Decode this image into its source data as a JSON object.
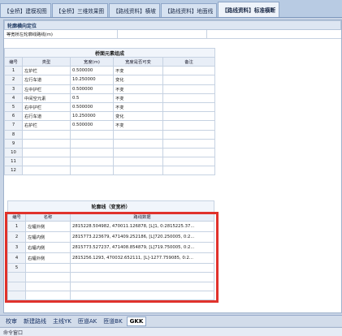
{
  "top_tabs": [
    {
      "label": "【全桥】建模视图",
      "active": false
    },
    {
      "label": "【全桥】三维效果图",
      "active": false
    },
    {
      "label": "【路线资料】横坡",
      "active": false
    },
    {
      "label": "【路线资料】地面线",
      "active": false
    },
    {
      "label": "【路线资料】标准横断",
      "active": true
    }
  ],
  "section1": {
    "title": "轮廓横向定位",
    "field_label": "等宽桥左轮廓线路线(m)",
    "field_value": ""
  },
  "section2": {
    "caption": "桥面元素组成",
    "headers": [
      "编号",
      "类型",
      "宽度(m)",
      "宽度是否可变",
      "备注"
    ],
    "rows": [
      {
        "no": "1",
        "type": "左护栏",
        "width": "0.500000",
        "variable": "不变",
        "note": ""
      },
      {
        "no": "2",
        "type": "左行车道",
        "width": "10.250000",
        "variable": "变化",
        "note": ""
      },
      {
        "no": "3",
        "type": "左中护栏",
        "width": "0.500000",
        "variable": "不变",
        "note": ""
      },
      {
        "no": "4",
        "type": "中间空元素",
        "width": "0.5",
        "variable": "不变",
        "note": ""
      },
      {
        "no": "5",
        "type": "右中护栏",
        "width": "0.500000",
        "variable": "不变",
        "note": ""
      },
      {
        "no": "6",
        "type": "右行车道",
        "width": "10.250000",
        "variable": "变化",
        "note": ""
      },
      {
        "no": "7",
        "type": "右护栏",
        "width": "0.500000",
        "variable": "不变",
        "note": ""
      },
      {
        "no": "8",
        "type": "",
        "width": "",
        "variable": "",
        "note": ""
      },
      {
        "no": "9",
        "type": "",
        "width": "",
        "variable": "",
        "note": ""
      },
      {
        "no": "10",
        "type": "",
        "width": "",
        "variable": "",
        "note": ""
      },
      {
        "no": "11",
        "type": "",
        "width": "",
        "variable": "",
        "note": ""
      },
      {
        "no": "12",
        "type": "",
        "width": "",
        "variable": "",
        "note": ""
      }
    ]
  },
  "section3": {
    "caption": "轮廓线（变宽桥）",
    "headers": [
      "编号",
      "名称",
      "路线数据"
    ],
    "rows": [
      {
        "no": "1",
        "name": "左幅外侧",
        "data": "2815228.504982, 470011.126878, [L]1, 0:2815225.37..."
      },
      {
        "no": "2",
        "name": "左幅内侧",
        "data": "2815773.223679, 471409.252186, [L]720.250005, 0:2..."
      },
      {
        "no": "3",
        "name": "右幅内侧",
        "data": "2815773.527237, 471408.854879, [L]719.750005, 0:2..."
      },
      {
        "no": "4",
        "name": "右幅外侧",
        "data": "2815256.1293, 470032.652111, [L]-1277.759085, 0:2..."
      },
      {
        "no": "5",
        "name": "",
        "data": ""
      },
      {
        "no": "",
        "name": "",
        "data": ""
      },
      {
        "no": "",
        "name": "",
        "data": ""
      },
      {
        "no": "",
        "name": "",
        "data": ""
      }
    ]
  },
  "bottom_tabs": [
    {
      "label": "校审",
      "active": false
    },
    {
      "label": "新建路线",
      "active": false
    },
    {
      "label": "主线YK",
      "active": false
    },
    {
      "label": "匝道AK",
      "active": false
    },
    {
      "label": "匝道BK",
      "active": false
    },
    {
      "label": "GKK",
      "active": true
    }
  ],
  "command_bar": "命令窗口",
  "colors": {
    "highlight_box": "#e0322c",
    "section_header": "#dde6f2"
  }
}
